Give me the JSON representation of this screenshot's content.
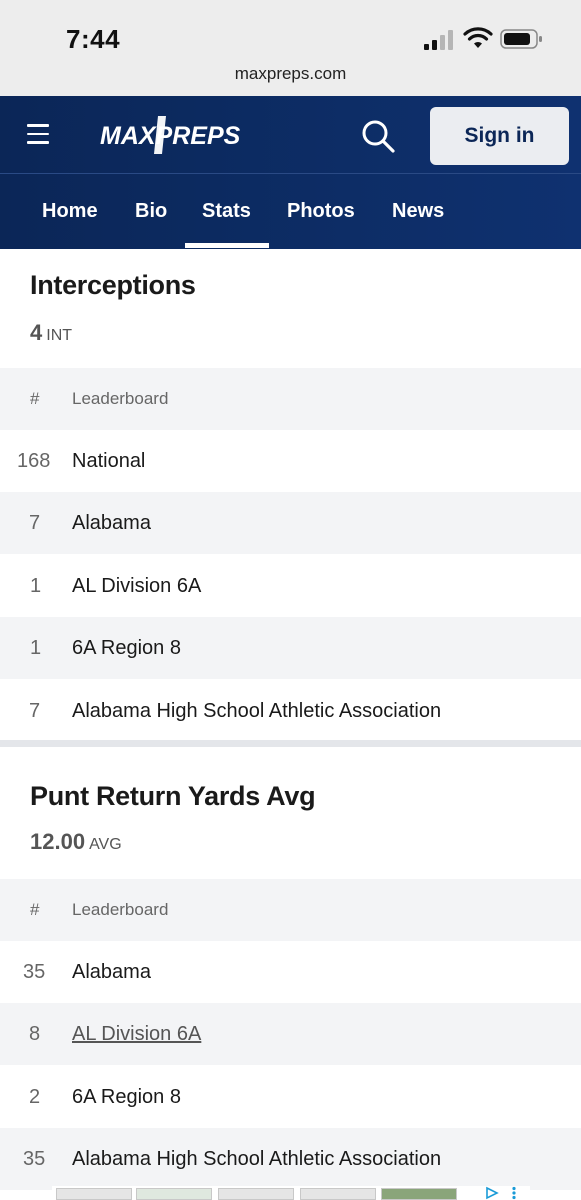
{
  "status_bar": {
    "time": "7:44",
    "url": "maxpreps.com"
  },
  "header": {
    "logo_text": "MAXPREPS",
    "sign_in_label": "Sign in",
    "tabs": [
      {
        "label": "Home",
        "active": false
      },
      {
        "label": "Bio",
        "active": false
      },
      {
        "label": "Stats",
        "active": true
      },
      {
        "label": "Photos",
        "active": false
      },
      {
        "label": "News",
        "active": false
      }
    ]
  },
  "sections": [
    {
      "title": "Interceptions",
      "value": "4",
      "unit": "INT",
      "columns": {
        "rank": "#",
        "board": "Leaderboard"
      },
      "rows": [
        {
          "rank": "168",
          "board": "National"
        },
        {
          "rank": "7",
          "board": "Alabama"
        },
        {
          "rank": "1",
          "board": "AL Division 6A"
        },
        {
          "rank": "1",
          "board": "6A Region 8"
        },
        {
          "rank": "7",
          "board": "Alabama High School Athletic Association"
        }
      ]
    },
    {
      "title": "Punt Return Yards Avg",
      "value": "12.00",
      "unit": "AVG",
      "columns": {
        "rank": "#",
        "board": "Leaderboard"
      },
      "rows": [
        {
          "rank": "35",
          "board": "Alabama"
        },
        {
          "rank": "8",
          "board": "AL Division 6A",
          "link": true
        },
        {
          "rank": "2",
          "board": "6A Region 8"
        },
        {
          "rank": "35",
          "board": "Alabama High School Athletic Association"
        }
      ]
    }
  ],
  "colors": {
    "header_bg": "#0b2657",
    "alt_row_bg": "#f3f4f6",
    "sign_in_bg": "#ebedf1"
  }
}
